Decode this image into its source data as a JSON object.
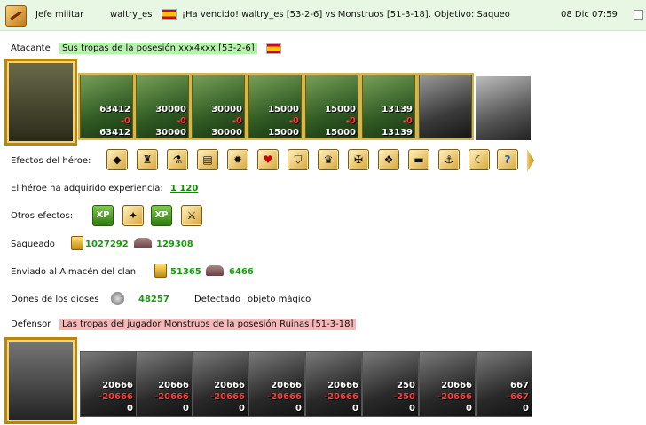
{
  "header": {
    "role": "Jefe militar",
    "user": "waltry_es",
    "message": "¡Ha vencido! waltry_es [53-2-6] vs Monstruos [51-3-18]. Objetivo: Saqueo",
    "datetime": "08 Dic 07:59"
  },
  "attacker": {
    "label": "Atacante",
    "title": "Sus tropas de la posesión xxx4xxx [53-2-6]",
    "units": [
      {
        "count": "63412",
        "loss": "-0",
        "remain": "63412"
      },
      {
        "count": "30000",
        "loss": "-0",
        "remain": "30000"
      },
      {
        "count": "30000",
        "loss": "-0",
        "remain": "30000"
      },
      {
        "count": "15000",
        "loss": "-0",
        "remain": "15000"
      },
      {
        "count": "15000",
        "loss": "-0",
        "remain": "15000"
      },
      {
        "count": "13139",
        "loss": "-0",
        "remain": "13139"
      }
    ]
  },
  "effects": {
    "label": "Efectos del héroe:"
  },
  "experience": {
    "label": "El héroe ha adquirido experiencia:",
    "value": "1 120"
  },
  "other_effects": {
    "label": "Otros efectos:",
    "xp1": "XP",
    "xp2": "XP"
  },
  "loot": {
    "label": "Saqueado",
    "gold": "1027292",
    "ore": "129308"
  },
  "clan": {
    "label": "Enviado al Almacén del clan",
    "gold": "51365",
    "ore": "6466"
  },
  "gods": {
    "label": "Dones de los dioses",
    "value": "48257",
    "detected_label": "Detectado",
    "detected_link": "objeto mágico"
  },
  "defender": {
    "label": "Defensor",
    "title": "Las tropas del jugador Monstruos de la posesión Ruinas [51-3-18]",
    "units": [
      {
        "count": "20666",
        "loss": "-20666",
        "remain": "0"
      },
      {
        "count": "20666",
        "loss": "-20666",
        "remain": "0"
      },
      {
        "count": "20666",
        "loss": "-20666",
        "remain": "0"
      },
      {
        "count": "20666",
        "loss": "-20666",
        "remain": "0"
      },
      {
        "count": "20666",
        "loss": "-20666",
        "remain": "0"
      },
      {
        "count": "250",
        "loss": "-250",
        "remain": "0"
      },
      {
        "count": "20666",
        "loss": "-20666",
        "remain": "0"
      },
      {
        "count": "667",
        "loss": "-667",
        "remain": "0"
      }
    ]
  }
}
